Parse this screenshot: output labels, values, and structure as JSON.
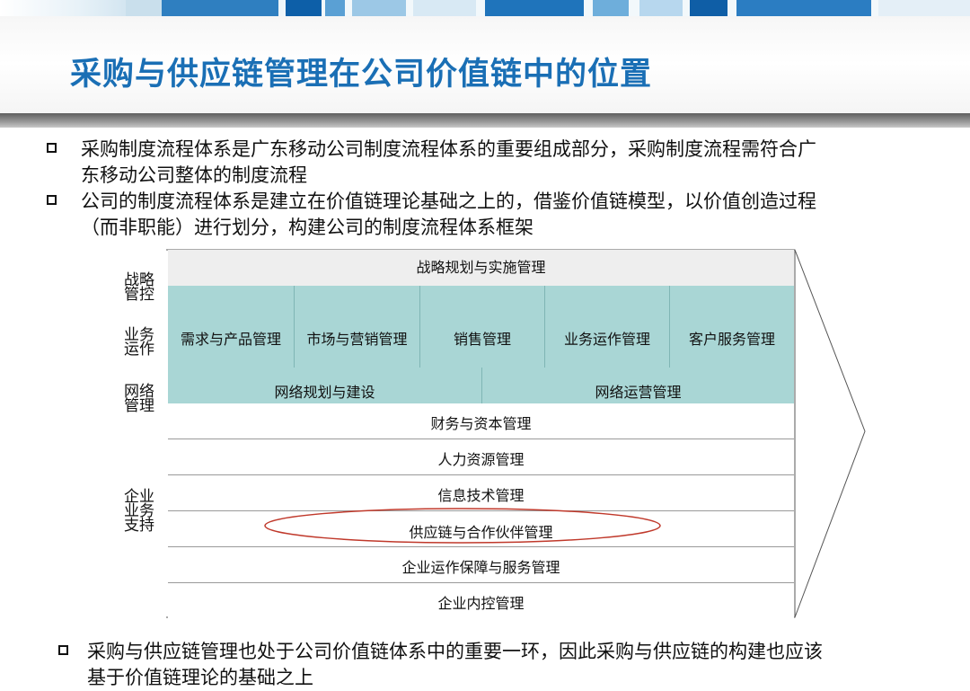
{
  "title": "采购与供应链管理在公司价值链中的位置",
  "bullets": [
    {
      "line1": "采购制度流程体系是广东移动公司制度流程体系的重要组成部分，采购制度流程需符合广",
      "line2": "东移动公司整体的制度流程"
    },
    {
      "line1": "公司的制度流程体系是建立在价值链理论基础之上的，借鉴价值链模型，以价值创造过程",
      "line2": "（而非职能）进行划分，构建公司的制度流程体系框架"
    },
    {
      "line1": "采购与供应链管理也处于公司价值链体系中的重要一环，因此采购与供应链的构建也应该",
      "line2": "基于价值链理论的基础之上"
    }
  ],
  "diagram": {
    "side_labels": {
      "strategy": [
        "战略",
        "管控"
      ],
      "operations": [
        "业务",
        "运作"
      ],
      "network": [
        "网络",
        "管理"
      ],
      "support": [
        "企业",
        "业务",
        "支持"
      ]
    },
    "strategy_row": "战略规划与实施管理",
    "operations_cells": [
      "需求与产品管理",
      "市场与营销管理",
      "销售管理",
      "业务运作管理",
      "客户服务管理"
    ],
    "network_cells": [
      "网络规划与建设",
      "网络运营管理"
    ],
    "support_rows": [
      "财务与资本管理",
      "人力资源管理",
      "信息技术管理",
      "供应链与合作伙伴管理",
      "企业运作保障与服务管理",
      "企业内控管理"
    ],
    "highlight_color": "#c0392b",
    "teal_color": "#a9d6d5"
  },
  "colors": {
    "title": "#1a6fb5",
    "header_bar": "#7a7a7a"
  }
}
